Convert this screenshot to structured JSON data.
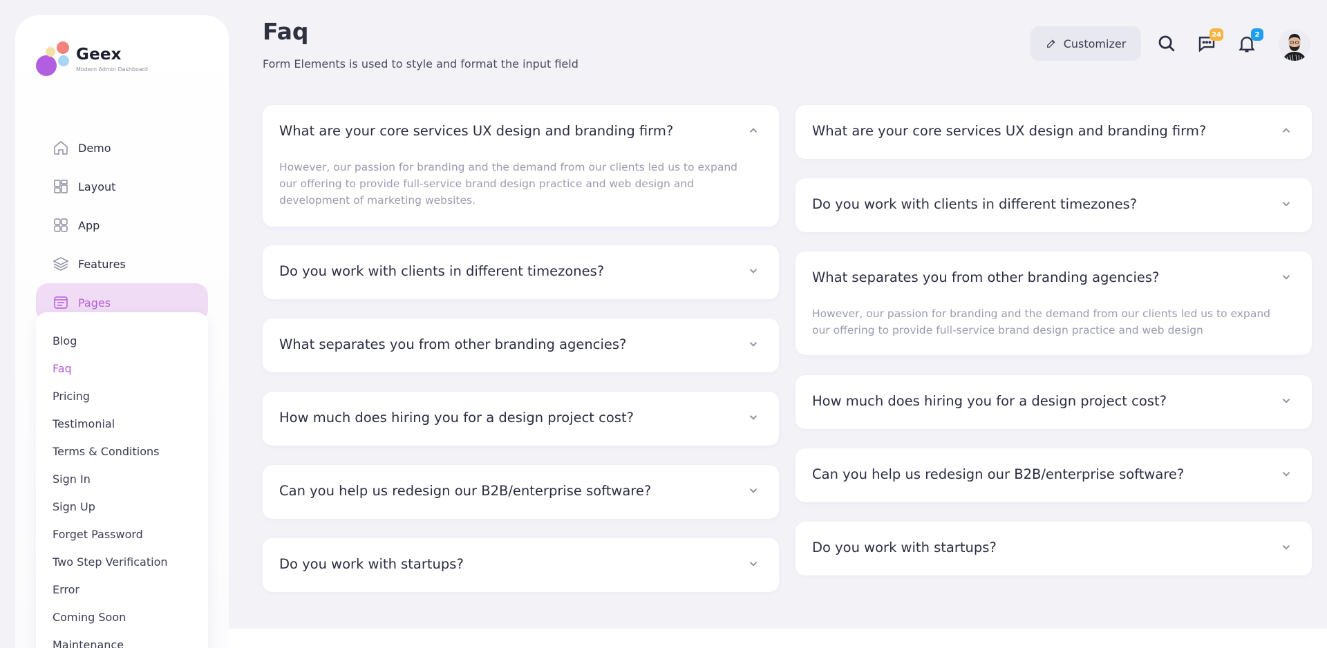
{
  "brand": {
    "name": "Geex",
    "tagline": "Modern Admin Dashboard"
  },
  "nav": [
    {
      "label": "Demo",
      "icon": "home-icon"
    },
    {
      "label": "Layout",
      "icon": "layout-icon"
    },
    {
      "label": "App",
      "icon": "apps-grid-icon"
    },
    {
      "label": "Features",
      "icon": "layers-icon"
    },
    {
      "label": "Pages",
      "icon": "pages-icon",
      "active": true
    }
  ],
  "submenu": [
    {
      "label": "Blog"
    },
    {
      "label": "Faq",
      "active": true
    },
    {
      "label": "Pricing"
    },
    {
      "label": "Testimonial"
    },
    {
      "label": "Terms & Conditions"
    },
    {
      "label": "Sign In"
    },
    {
      "label": "Sign Up"
    },
    {
      "label": "Forget Password"
    },
    {
      "label": "Two Step Verification"
    },
    {
      "label": "Error"
    },
    {
      "label": "Coming Soon"
    },
    {
      "label": "Maintenance"
    }
  ],
  "header": {
    "title": "Faq",
    "description": "Form Elements is used to style and format the input field",
    "customizer_label": "Customizer",
    "messages_badge": "24",
    "notifications_badge": "2"
  },
  "colors": {
    "accent": "#b55fd8",
    "messages_badge": "#f6b545",
    "notifications_badge": "#1f9ef0"
  },
  "faq_left": [
    {
      "question": "What are your core services UX design and branding firm?",
      "expanded": true,
      "answer": "However, our passion for branding and the demand from our clients led us to expand our offering to provide full-service brand design practice and web design and development of marketing websites."
    },
    {
      "question": "Do you work with clients in different timezones?",
      "expanded": false
    },
    {
      "question": "What separates you from other branding agencies?",
      "expanded": false
    },
    {
      "question": "How much does hiring you for a design project cost?",
      "expanded": false
    },
    {
      "question": "Can you help us redesign our B2B/enterprise software?",
      "expanded": false
    },
    {
      "question": "Do you work with startups?",
      "expanded": false
    }
  ],
  "faq_right": [
    {
      "question": "What are your core services UX design and branding firm?",
      "expanded": true
    },
    {
      "question": "Do you work with clients in different timezones?",
      "expanded": false
    },
    {
      "question": "What separates you from other branding agencies?",
      "expanded": true,
      "answer": "However, our passion for branding and the demand from our clients led us to expand our offering to provide full-service brand design practice and web design"
    },
    {
      "question": "How much does hiring you for a design project cost?",
      "expanded": false
    },
    {
      "question": "Can you help us redesign our B2B/enterprise software?",
      "expanded": false
    },
    {
      "question": "Do you work with startups?",
      "expanded": false
    }
  ]
}
